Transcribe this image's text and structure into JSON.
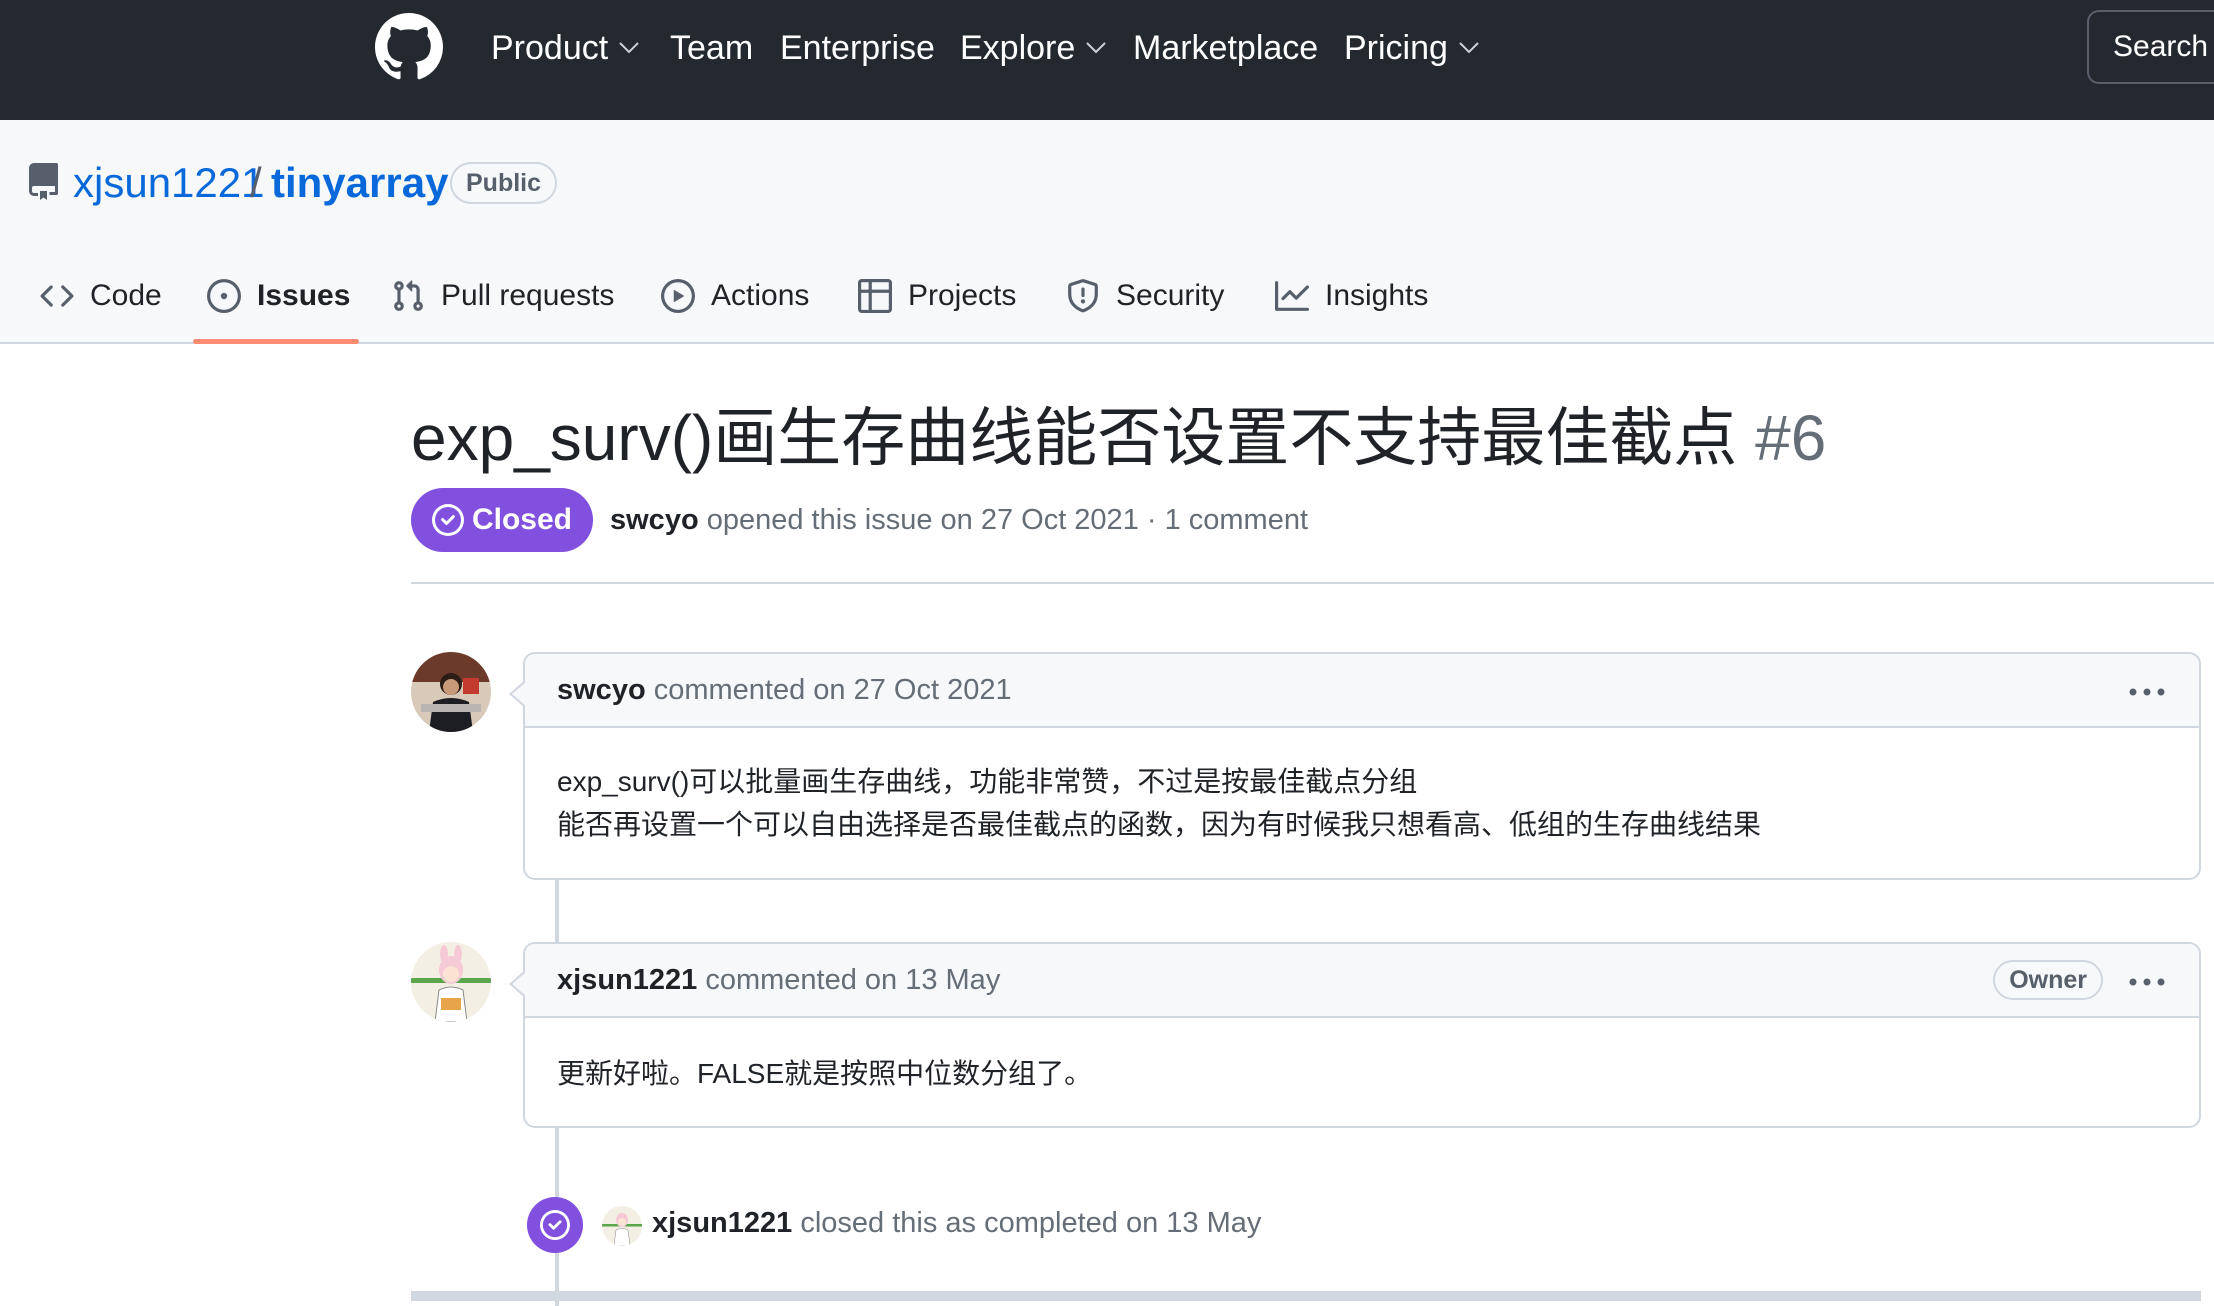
{
  "topnav": {
    "items": [
      {
        "label": "Product",
        "dropdown": true
      },
      {
        "label": "Team",
        "dropdown": false
      },
      {
        "label": "Enterprise",
        "dropdown": false
      },
      {
        "label": "Explore",
        "dropdown": true
      },
      {
        "label": "Marketplace",
        "dropdown": false
      },
      {
        "label": "Pricing",
        "dropdown": true
      }
    ],
    "search_label": "Search"
  },
  "repo": {
    "owner": "xjsun1221",
    "separator": "/",
    "name": "tinyarray",
    "visibility": "Public"
  },
  "tabs": [
    {
      "label": "Code",
      "icon": "code-icon",
      "selected": false
    },
    {
      "label": "Issues",
      "icon": "issue-opened-icon",
      "selected": true
    },
    {
      "label": "Pull requests",
      "icon": "git-pull-request-icon",
      "selected": false
    },
    {
      "label": "Actions",
      "icon": "play-icon",
      "selected": false
    },
    {
      "label": "Projects",
      "icon": "table-icon",
      "selected": false
    },
    {
      "label": "Security",
      "icon": "shield-icon",
      "selected": false
    },
    {
      "label": "Insights",
      "icon": "graph-icon",
      "selected": false
    }
  ],
  "issue": {
    "title": "exp_surv()画生存曲线能否设置不支持最佳截点",
    "number": "#6",
    "state": "Closed",
    "author": "swcyo",
    "opened_text": "opened this issue on 27 Oct 2021 · 1 comment"
  },
  "comments": [
    {
      "author": "swcyo",
      "header_text": "commented on 27 Oct 2021",
      "owner_badge": "",
      "body": [
        "exp_surv()可以批量画生存曲线，功能非常赞，不过是按最佳截点分组",
        "能否再设置一个可以自由选择是否最佳截点的函数，因为有时候我只想看高、低组的生存曲线结果"
      ]
    },
    {
      "author": "xjsun1221",
      "header_text": "commented on 13 May",
      "owner_badge": "Owner",
      "body": [
        "更新好啦。FALSE就是按照中位数分组了。"
      ]
    }
  ],
  "event": {
    "actor": "xjsun1221",
    "text": "closed this as completed on 13 May"
  },
  "colors": {
    "header_bg": "#24292f",
    "link": "#0969da",
    "closed_purple": "#8250df",
    "tab_underline": "#fd8c73",
    "border": "#d0d7de"
  }
}
